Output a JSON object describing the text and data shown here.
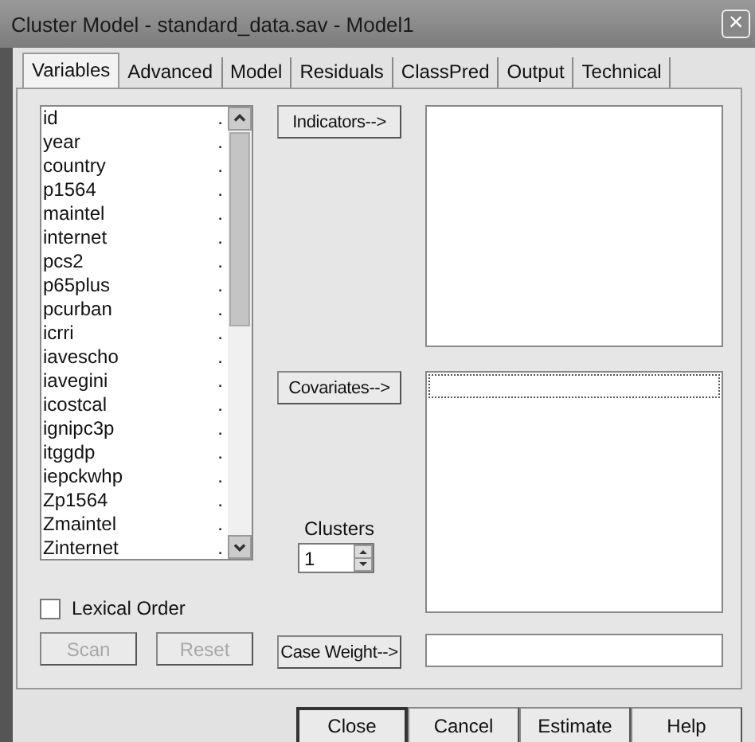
{
  "window": {
    "title": "Cluster Model - standard_data.sav - Model1",
    "close": "×"
  },
  "tabs": [
    {
      "label": "Variables",
      "selected": true
    },
    {
      "label": "Advanced",
      "selected": false
    },
    {
      "label": "Model",
      "selected": false
    },
    {
      "label": "Residuals",
      "selected": false
    },
    {
      "label": "ClassPred",
      "selected": false
    },
    {
      "label": "Output",
      "selected": false
    },
    {
      "label": "Technical",
      "selected": false
    }
  ],
  "variables": {
    "items": [
      {
        "name": "id",
        "marker": "."
      },
      {
        "name": "year",
        "marker": "."
      },
      {
        "name": "country",
        "marker": "."
      },
      {
        "name": "p1564",
        "marker": "."
      },
      {
        "name": "maintel",
        "marker": "."
      },
      {
        "name": "internet",
        "marker": "."
      },
      {
        "name": "pcs2",
        "marker": "."
      },
      {
        "name": "p65plus",
        "marker": "."
      },
      {
        "name": "pcurban",
        "marker": "."
      },
      {
        "name": "icrri",
        "marker": "."
      },
      {
        "name": "iavescho",
        "marker": "."
      },
      {
        "name": "iavegini",
        "marker": "."
      },
      {
        "name": "icostcal",
        "marker": "."
      },
      {
        "name": "ignipc3p",
        "marker": "."
      },
      {
        "name": "itggdp",
        "marker": "."
      },
      {
        "name": "iepckwhp",
        "marker": "."
      },
      {
        "name": "Zp1564",
        "marker": "."
      },
      {
        "name": "Zmaintel",
        "marker": "."
      },
      {
        "name": "Zinternet",
        "marker": "."
      }
    ]
  },
  "lexical_order": {
    "label": "Lexical Order",
    "checked": false
  },
  "left_buttons": [
    {
      "label": "Scan",
      "disabled": true
    },
    {
      "label": "Reset",
      "disabled": true
    }
  ],
  "indicators_button": "Indicators-->",
  "covariates_button": "Covariates-->",
  "clusters": {
    "label": "Clusters",
    "value": "1"
  },
  "case_weight_button": "Case Weight-->",
  "footer_buttons": [
    {
      "label": "Close",
      "default": true
    },
    {
      "label": "Cancel",
      "default": false
    },
    {
      "label": "Estimate",
      "default": false
    },
    {
      "label": "Help",
      "default": false
    }
  ]
}
